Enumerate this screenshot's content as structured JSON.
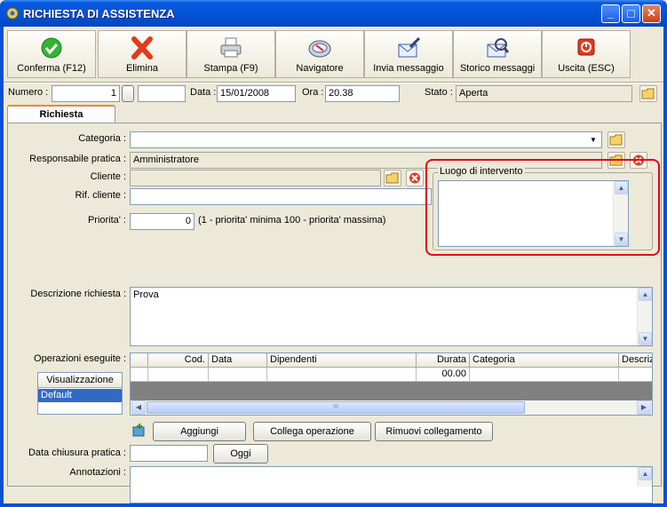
{
  "window": {
    "title": "RICHIESTA DI ASSISTENZA",
    "min_glyph": "_",
    "max_glyph": "□",
    "close_glyph": "✕"
  },
  "toolbar": {
    "buttons": [
      {
        "label": "Conferma (F12)",
        "icon": "check-icon"
      },
      {
        "label": "Elimina",
        "icon": "delete-x-icon"
      },
      {
        "label": "Stampa (F9)",
        "icon": "printer-icon"
      },
      {
        "label": "Navigatore",
        "icon": "compass-icon"
      },
      {
        "label": "Invia messaggio",
        "icon": "send-mail-icon"
      },
      {
        "label": "Storico messaggi",
        "icon": "mail-history-icon"
      },
      {
        "label": "Uscita (ESC)",
        "icon": "exit-icon"
      }
    ]
  },
  "header": {
    "numero_label": "Numero :",
    "numero_value": "1",
    "numero_suffix_value": "",
    "data_label": "Data :",
    "data_value": "15/01/2008",
    "ora_label": "Ora :",
    "ora_value": "20.38",
    "stato_label": "Stato :",
    "stato_value": "Aperta"
  },
  "tabs": [
    {
      "label": "Richiesta",
      "active": true
    }
  ],
  "form": {
    "categoria_label": "Categoria :",
    "categoria_value": "",
    "responsabile_label": "Responsabile pratica :",
    "responsabile_value": "Amministratore",
    "cliente_label": "Cliente :",
    "cliente_value": "",
    "rif_cliente_label": "Rif. cliente :",
    "rif_cliente_value": "",
    "priorita_label": "Priorita' :",
    "priorita_value": "0",
    "priorita_hint": "(1 - priorita' minima  100 - priorita' massima)",
    "luogo_label": "Luogo di intervento",
    "luogo_value": "",
    "descrizione_label": "Descrizione richiesta :",
    "descrizione_value": "Prova",
    "operazioni_label": "Operazioni eseguite :",
    "data_chiusura_label": "Data chiusura pratica :",
    "data_chiusura_value": "",
    "oggi_label": "Oggi",
    "annotazioni_label": "Annotazioni :",
    "annotazioni_value": ""
  },
  "visualizzazione": {
    "header": "Visualizzazione",
    "items": [
      "Default"
    ]
  },
  "grid": {
    "columns": [
      "",
      "Cod.",
      "Data",
      "Dipendenti",
      "Durata",
      "Categoria",
      "Descriz"
    ],
    "rows": [
      [
        "",
        "",
        "",
        "",
        "00.00",
        "",
        ""
      ]
    ],
    "hscroll_thumb_glyph": "III"
  },
  "actions": {
    "aggiungi": "Aggiungi",
    "collega": "Collega operazione",
    "rimuovi": "Rimuovi collegamento"
  },
  "colors": {
    "title_bar": "#0553d8",
    "highlight_box": "#e0001a",
    "selected_item": "#316ac5",
    "grid_empty": "#808080"
  }
}
